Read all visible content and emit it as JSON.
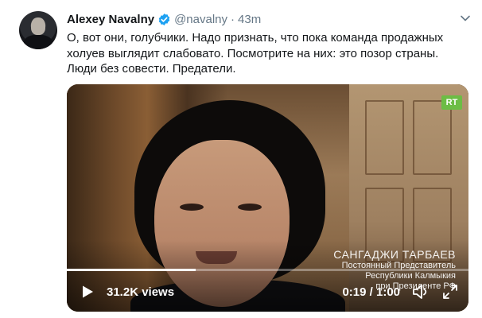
{
  "tweet": {
    "author_name": "Alexey Navalny",
    "handle": "@navalny",
    "separator": "·",
    "time": "43m",
    "text": "О, вот они, голубчики. Надо признать, что пока команда продажных холуев выглядит слабовато. Посмотрите на них: это позор страны. Люди без совести. Предатели."
  },
  "video": {
    "channel_logo": "RT",
    "caption_name": "САНГАДЖИ ТАРБАЕВ",
    "caption_line1": "Постоянный Представитель",
    "caption_line2": "Республики Калмыкия",
    "caption_line3": "при Президенте РФ",
    "views": "31.2K views",
    "time_display": "0:19 / 1:00",
    "progress_fraction": 0.32
  },
  "icons": {
    "verified": "verified-badge-icon",
    "menu": "chevron-down-icon",
    "play": "play-icon",
    "volume": "volume-icon",
    "fullscreen": "fullscreen-icon"
  },
  "colors": {
    "verified_blue": "#1da1f2",
    "secondary_text": "#657786",
    "rt_green": "#6cbd45"
  }
}
